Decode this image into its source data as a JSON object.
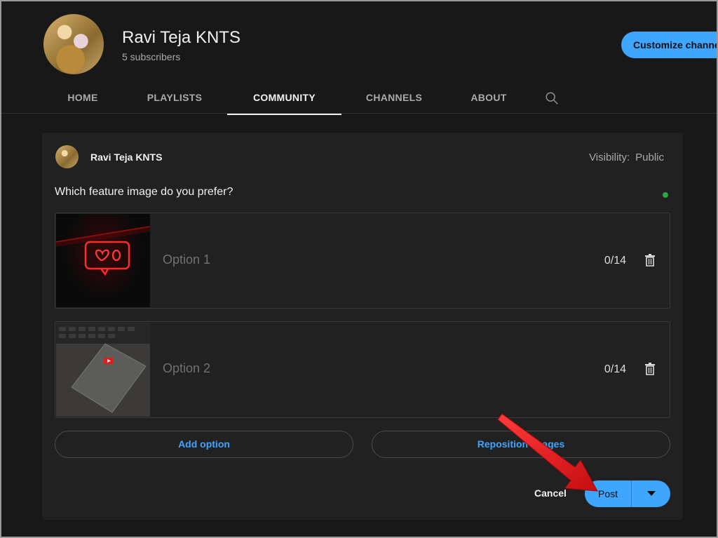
{
  "channel": {
    "name": "Ravi Teja KNTS",
    "subscribers": "5 subscribers",
    "customize_label": "Customize channel"
  },
  "tabs": [
    {
      "label": "HOME"
    },
    {
      "label": "PLAYLISTS"
    },
    {
      "label": "COMMUNITY",
      "active": true
    },
    {
      "label": "CHANNELS"
    },
    {
      "label": "ABOUT"
    }
  ],
  "post": {
    "author": "Ravi Teja KNTS",
    "visibility_label": "Visibility:",
    "visibility_value": "Public",
    "question": "Which feature image do you prefer?",
    "options": [
      {
        "placeholder": "Option 1",
        "count": "0/14"
      },
      {
        "placeholder": "Option 2",
        "count": "0/14"
      }
    ],
    "add_option_label": "Add option",
    "reposition_label": "Reposition images",
    "cancel_label": "Cancel",
    "post_label": "Post"
  },
  "icons": {
    "search": "search-icon",
    "trash": "trash-icon",
    "dropdown": "caret-down-icon",
    "annotation": "red-arrow"
  },
  "colors": {
    "background": "#181818",
    "card": "#212121",
    "accent": "#3ea6ff",
    "annotation_arrow": "#e3141c"
  }
}
